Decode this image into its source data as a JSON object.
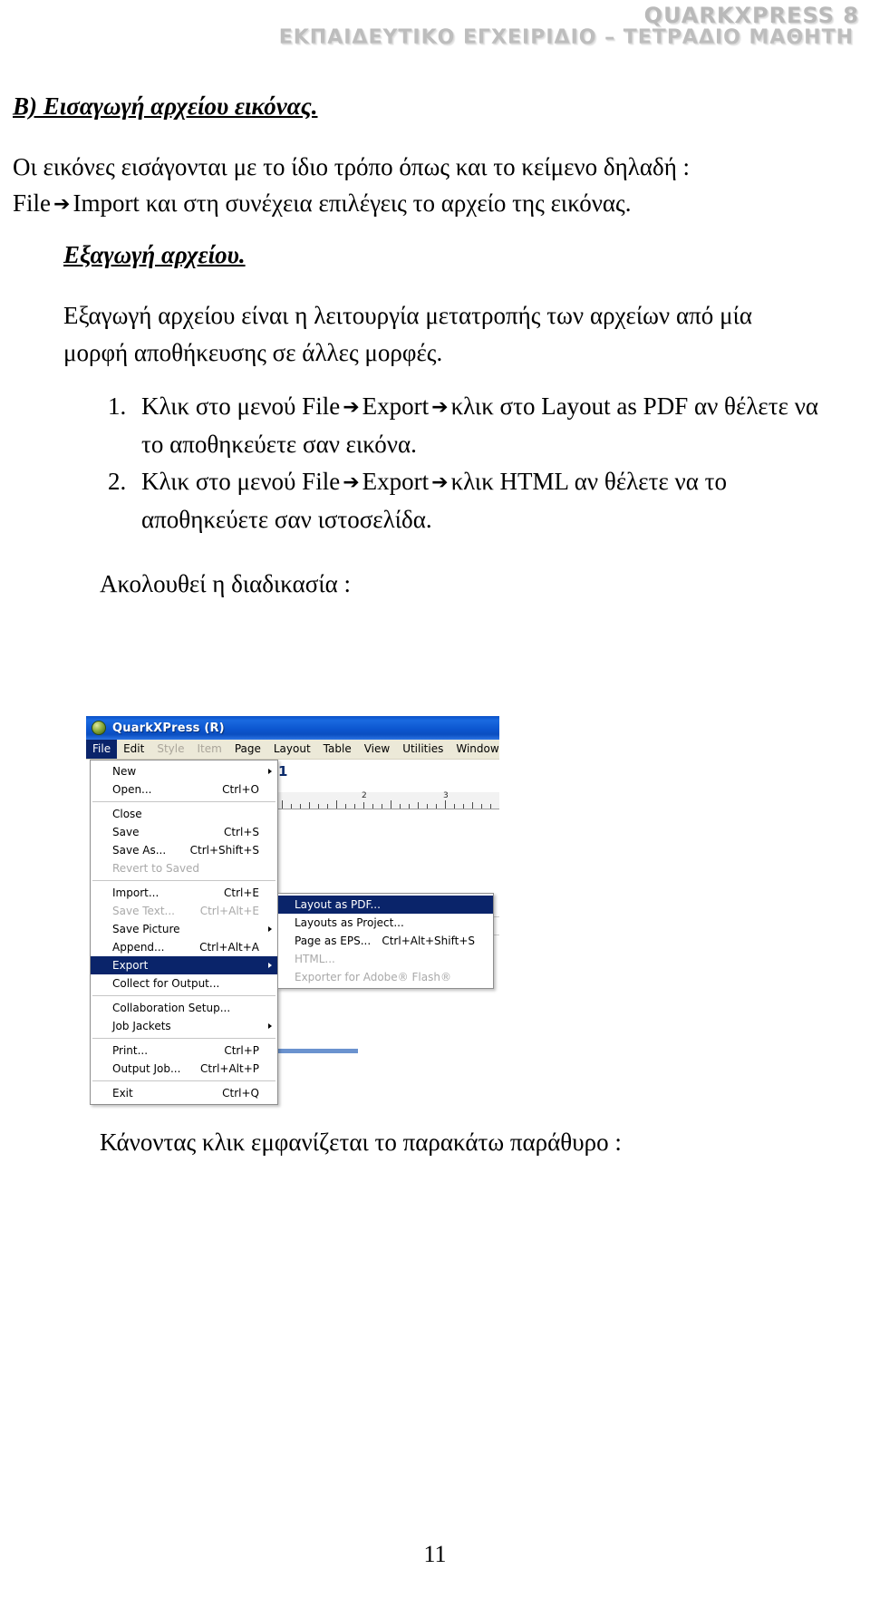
{
  "header": {
    "line1": "QUARKXPRESS 8",
    "line2": "ΕΚΠΑΙΔΕΥΤΙΚΟ ΕΓΧΕΙΡΙΔΙΟ – ΤΕΤΡΑΔΙΟ ΜΑΘΗΤΗ"
  },
  "body": {
    "heading_b": "Β) Εισαγωγή αρχείου εικόνας.",
    "para1_line1": "Οι εικόνες εισάγονται με το ίδιο τρόπο όπως και το κείμενο δηλαδή :",
    "para1_line2_pre": "File",
    "para1_line2_post": "Import και στη συνέχεια επιλέγεις το αρχείο της εικόνας.",
    "subheading_export": "Εξαγωγή αρχείου.",
    "para2": "Εξαγωγή αρχείου είναι η λειτουργία μετατροπής των αρχείων από μία μορφή αποθήκευσης σε άλλες μορφές.",
    "steps": [
      {
        "seg1": "Κλικ στο μενού File",
        "seg2": "Export",
        "seg3": "κλικ στο Layout as PDF αν θέλετε να το αποθηκεύετε σαν εικόνα."
      },
      {
        "seg1": "Κλικ στο μενού File",
        "seg2": "Export",
        "seg3": "κλικ HTML αν θέλετε να το αποθηκεύετε σαν ιστοσελίδα."
      }
    ],
    "follows_line": "Ακολουθεί η διαδικασία :",
    "closing_line": "Κάνοντας κλικ εμφανίζεται το παρακάτω παράθυρο :",
    "arrow_glyph": "➔"
  },
  "screenshot": {
    "window_title": "QuarkXPress (R)",
    "menubar": [
      {
        "label": "File",
        "state": "active"
      },
      {
        "label": "Edit",
        "state": "normal"
      },
      {
        "label": "Style",
        "state": "disabled"
      },
      {
        "label": "Item",
        "state": "disabled"
      },
      {
        "label": "Page",
        "state": "normal"
      },
      {
        "label": "Layout",
        "state": "normal"
      },
      {
        "label": "Table",
        "state": "normal"
      },
      {
        "label": "View",
        "state": "normal"
      },
      {
        "label": "Utilities",
        "state": "normal"
      },
      {
        "label": "Window",
        "state": "normal"
      }
    ],
    "file_menu": [
      {
        "label": "New",
        "shortcut": "",
        "state": "normal",
        "submenu": true
      },
      {
        "label": "Open...",
        "shortcut": "Ctrl+O",
        "state": "normal",
        "submenu": false
      },
      {
        "separator": true
      },
      {
        "label": "Close",
        "shortcut": "",
        "state": "normal",
        "submenu": false
      },
      {
        "label": "Save",
        "shortcut": "Ctrl+S",
        "state": "normal",
        "submenu": false
      },
      {
        "label": "Save As...",
        "shortcut": "Ctrl+Shift+S",
        "state": "normal",
        "submenu": false
      },
      {
        "label": "Revert to Saved",
        "shortcut": "",
        "state": "disabled",
        "submenu": false
      },
      {
        "separator": true
      },
      {
        "label": "Import...",
        "shortcut": "Ctrl+E",
        "state": "normal",
        "submenu": false
      },
      {
        "label": "Save Text...",
        "shortcut": "Ctrl+Alt+E",
        "state": "disabled",
        "submenu": false
      },
      {
        "label": "Save Picture",
        "shortcut": "",
        "state": "normal",
        "submenu": true
      },
      {
        "label": "Append...",
        "shortcut": "Ctrl+Alt+A",
        "state": "normal",
        "submenu": false
      },
      {
        "label": "Export",
        "shortcut": "",
        "state": "selected",
        "submenu": true
      },
      {
        "label": "Collect for Output...",
        "shortcut": "",
        "state": "normal",
        "submenu": false
      },
      {
        "separator": true
      },
      {
        "label": "Collaboration Setup...",
        "shortcut": "",
        "state": "normal",
        "submenu": false
      },
      {
        "label": "Job Jackets",
        "shortcut": "",
        "state": "normal",
        "submenu": true
      },
      {
        "separator": true
      },
      {
        "label": "Print...",
        "shortcut": "Ctrl+P",
        "state": "normal",
        "submenu": false
      },
      {
        "label": "Output Job...",
        "shortcut": "Ctrl+Alt+P",
        "state": "normal",
        "submenu": false
      },
      {
        "separator": true
      },
      {
        "label": "Exit",
        "shortcut": "Ctrl+Q",
        "state": "normal",
        "submenu": false
      }
    ],
    "export_submenu": [
      {
        "label": "Layout as PDF...",
        "shortcut": "",
        "state": "selected",
        "submenu": false
      },
      {
        "label": "Layouts as Project...",
        "shortcut": "",
        "state": "normal",
        "submenu": false
      },
      {
        "label": "Page as EPS...",
        "shortcut": "Ctrl+Alt+Shift+S",
        "state": "normal",
        "submenu": false
      },
      {
        "label": "HTML...",
        "shortcut": "",
        "state": "disabled",
        "submenu": false
      },
      {
        "label": "Exporter for Adobe® Flash®",
        "shortcut": "",
        "state": "disabled",
        "submenu": false
      }
    ],
    "ruler_numbers": [
      "1",
      "2",
      "3"
    ],
    "colors": {
      "titlebar_blue": "#0c56d0",
      "highlight_blue": "#0a246a",
      "menubar_bg": "#ece9d8",
      "disabled_text": "#a9a9a9"
    }
  },
  "footer": {
    "page_number": "11"
  }
}
